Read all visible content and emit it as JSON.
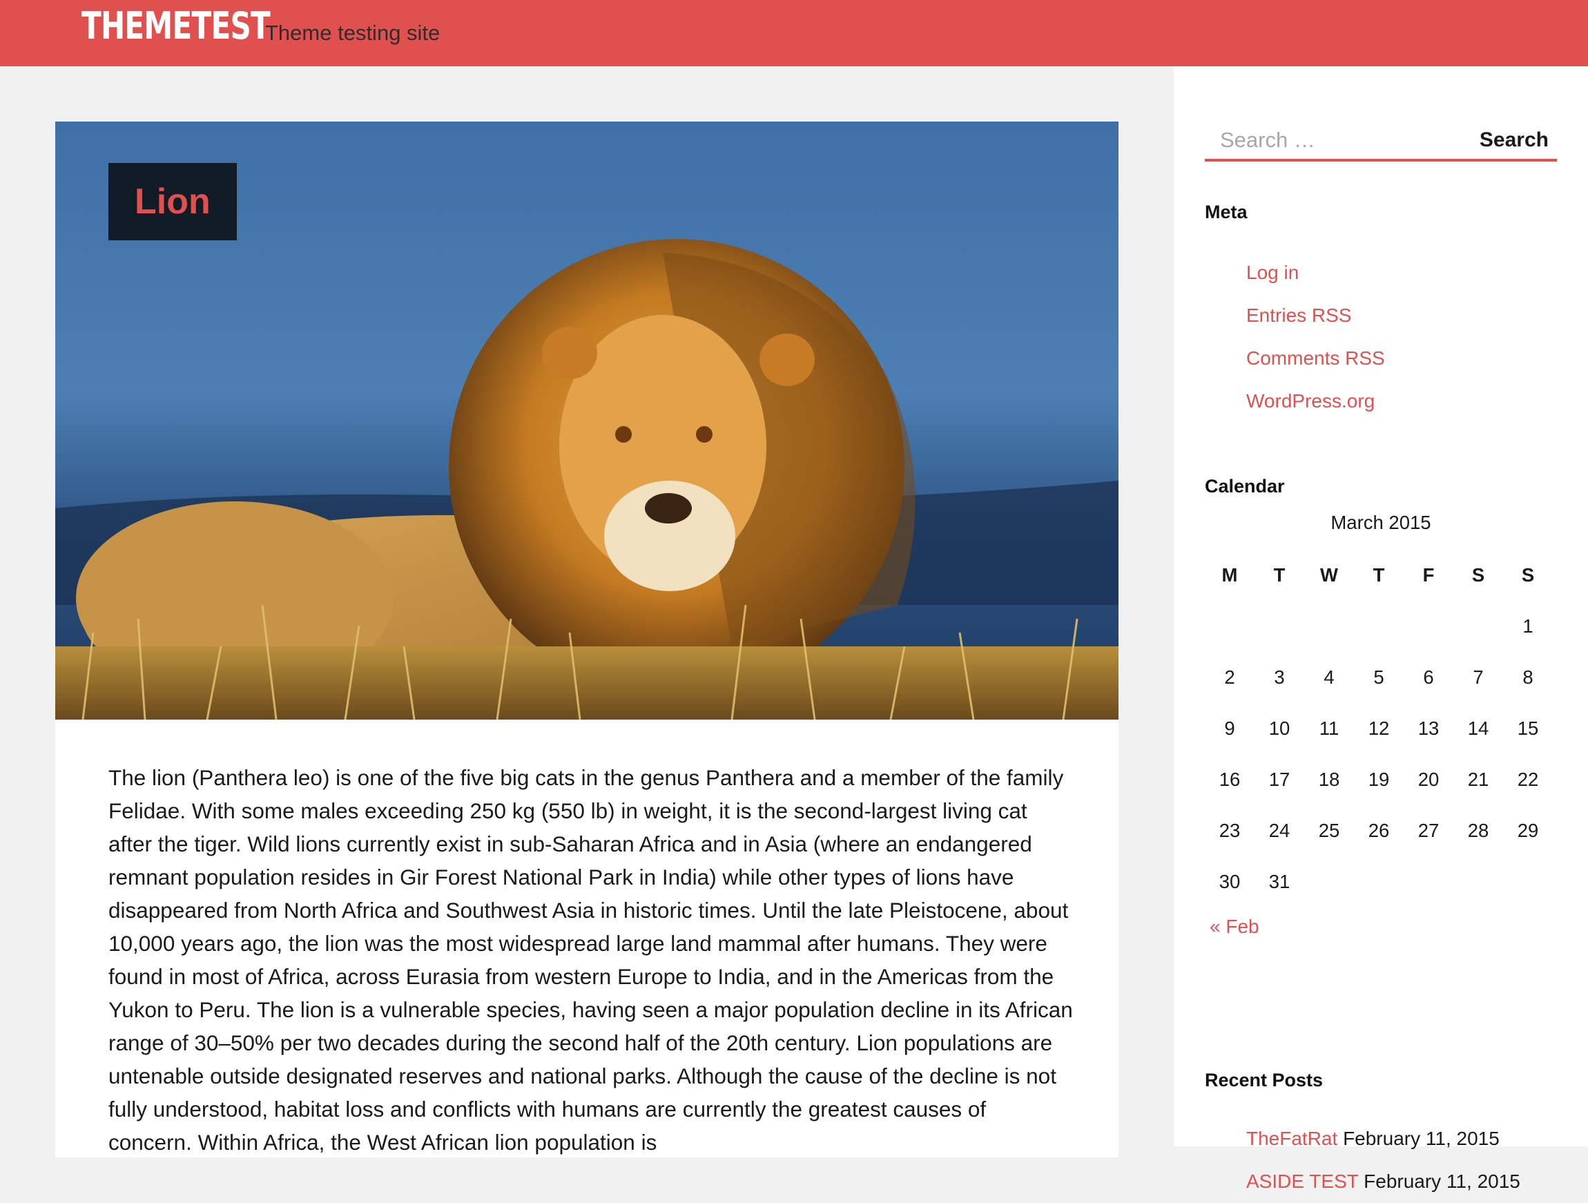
{
  "header": {
    "site_title": "THEMETEST",
    "site_description": "Theme testing site",
    "accent_color": "#e0504f"
  },
  "article": {
    "title": "Lion",
    "featured_image_icon": "lion-photo",
    "body": "The lion (Panthera leo) is one of the five big cats in the genus Panthera and a member of the family Felidae. With some males exceeding 250 kg (550 lb) in weight,  it is the second-largest living cat after the tiger. Wild lions currently exist in sub-Saharan Africa and in Asia (where an endangered remnant population resides in Gir Forest National Park in India) while other types of lions have disappeared from North Africa and Southwest Asia in historic times. Until the late Pleistocene, about 10,000 years ago, the lion was the most widespread large land mammal after humans. They were found in most of Africa, across Eurasia from western Europe to India, and in the Americas from the Yukon to Peru. The lion is a vulnerable species, having seen a major population decline in its African range of 30–50% per two decades during the second half of the 20th century. Lion populations are untenable outside designated reserves and national parks. Although the cause of the decline is not fully understood, habitat loss and conflicts with humans are currently the greatest causes of concern. Within Africa, the West African lion population is"
  },
  "sidebar": {
    "search": {
      "placeholder": "Search …",
      "button_label": "Search"
    },
    "meta": {
      "title": "Meta",
      "links": [
        "Log in",
        "Entries RSS",
        "Comments RSS",
        "WordPress.org"
      ]
    },
    "calendar": {
      "title": "Calendar",
      "caption": "March 2015",
      "weekdays": [
        "M",
        "T",
        "W",
        "T",
        "F",
        "S",
        "S"
      ],
      "rows": [
        [
          "",
          "",
          "",
          "",
          "",
          "",
          "1"
        ],
        [
          "2",
          "3",
          "4",
          "5",
          "6",
          "7",
          "8"
        ],
        [
          "9",
          "10",
          "11",
          "12",
          "13",
          "14",
          "15"
        ],
        [
          "16",
          "17",
          "18",
          "19",
          "20",
          "21",
          "22"
        ],
        [
          "23",
          "24",
          "25",
          "26",
          "27",
          "28",
          "29"
        ],
        [
          "30",
          "31",
          "",
          "",
          "",
          "",
          ""
        ]
      ],
      "prev_link": "« Feb"
    },
    "recent_posts": {
      "title": "Recent Posts",
      "items": [
        {
          "title": "TheFatRat",
          "date": "February 11, 2015"
        },
        {
          "title": "ASIDE TEST",
          "date": "February 11, 2015"
        }
      ]
    }
  }
}
